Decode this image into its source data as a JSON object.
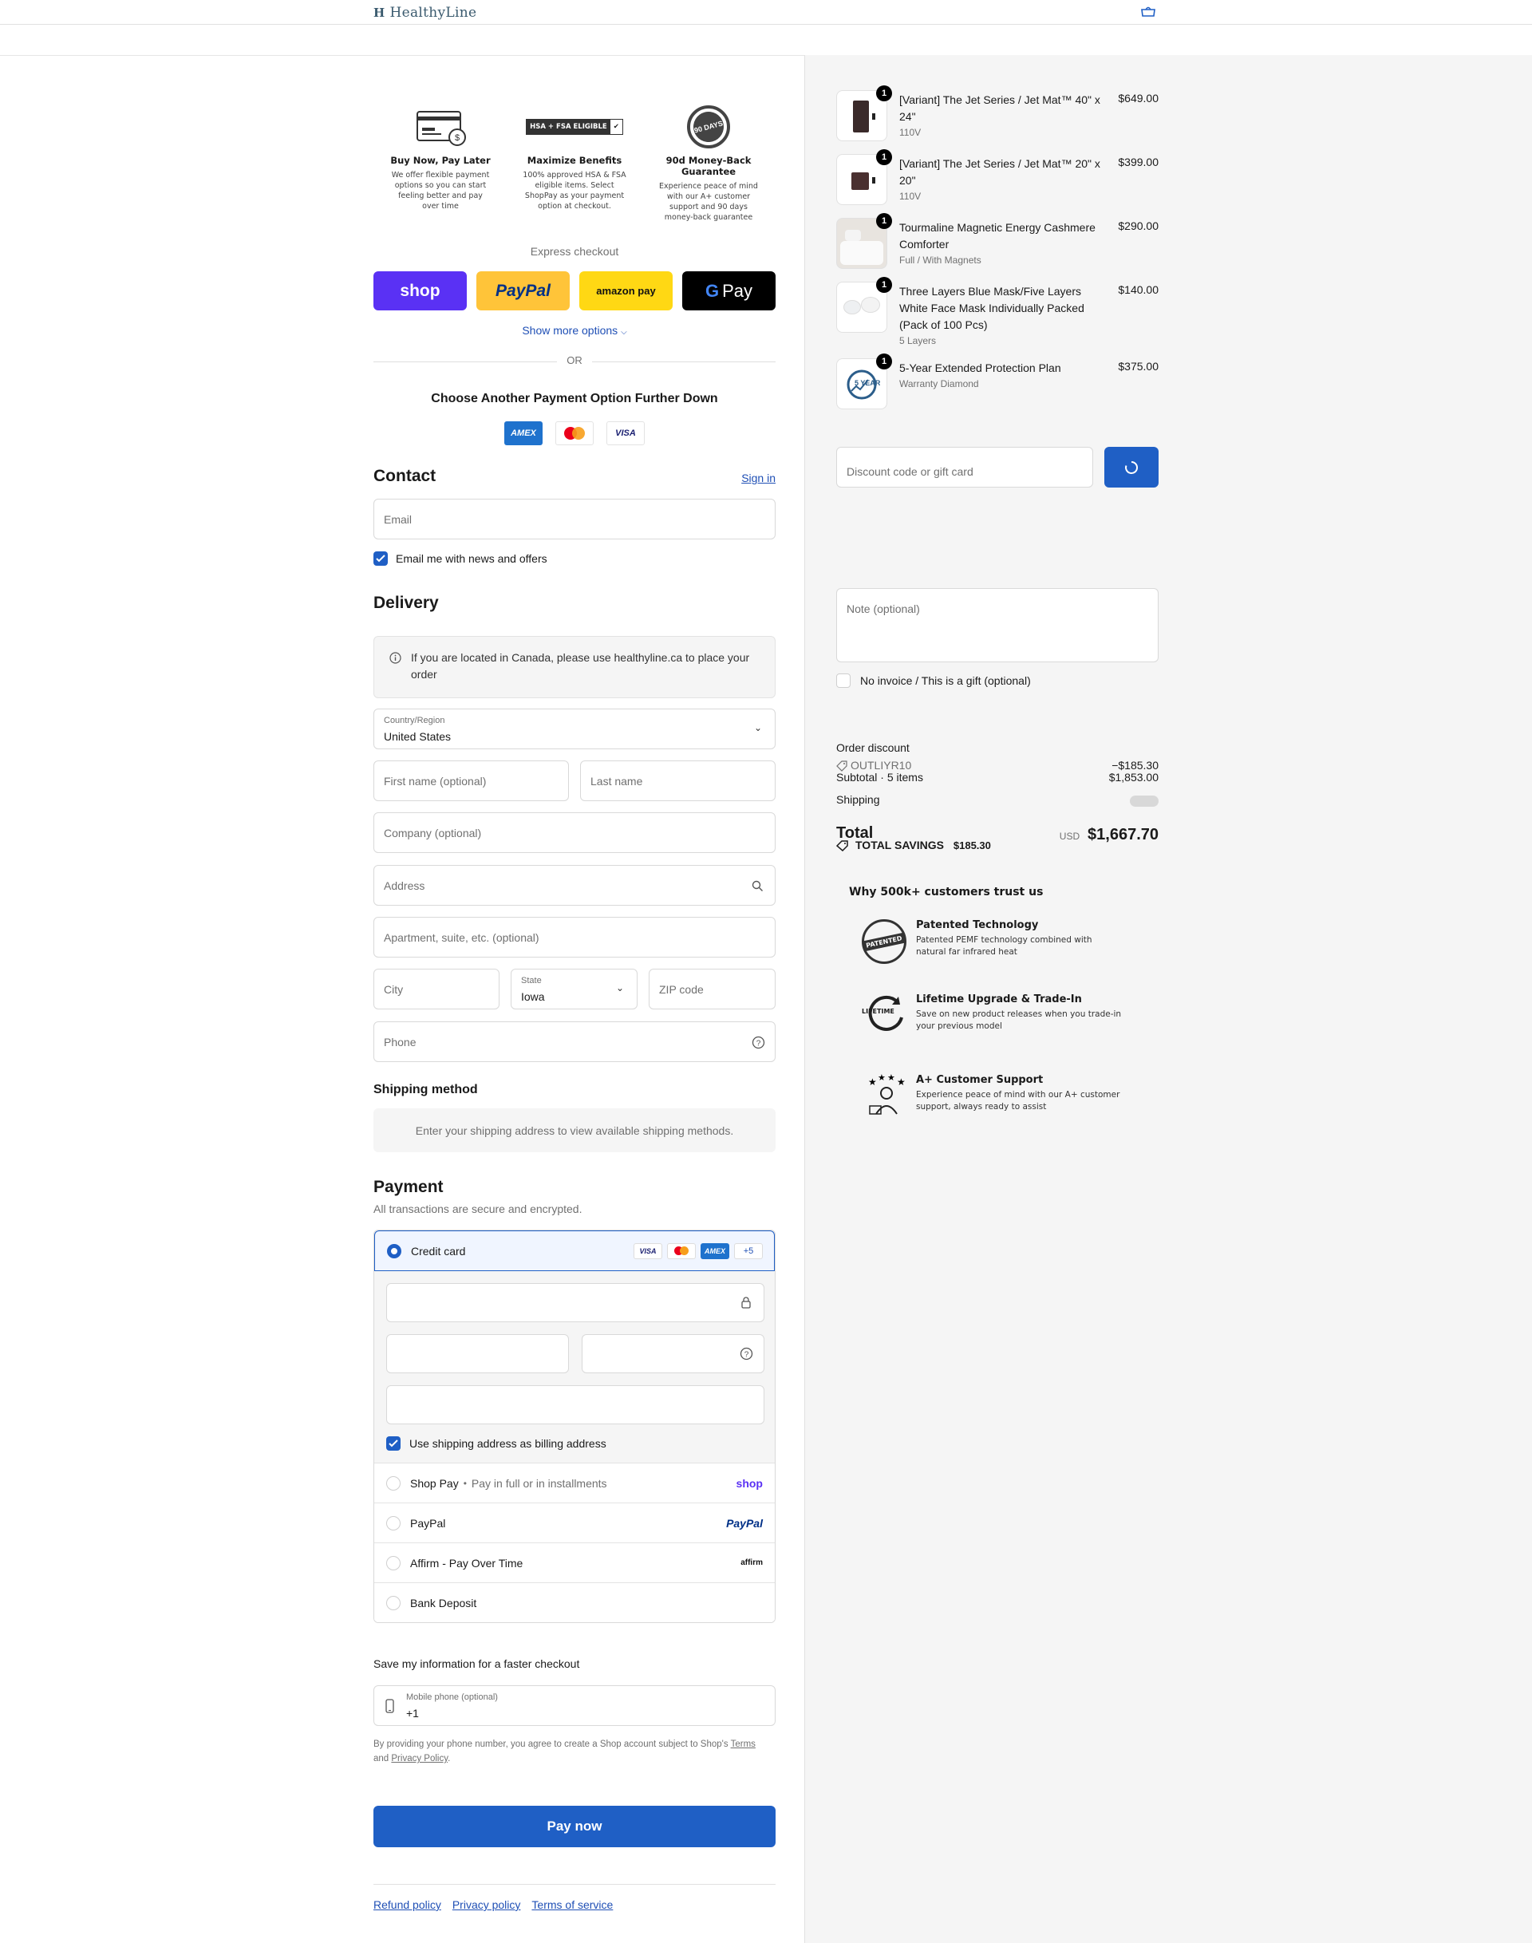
{
  "header": {
    "brand": "HealthyLine"
  },
  "trust_badges": [
    {
      "title": "Buy Now, Pay Later",
      "desc": "We offer flexible payment options so you can start feeling better and pay over time"
    },
    {
      "title": "Maximize Benefits",
      "desc": "100% approved HSA & FSA eligible items. Select ShopPay as your payment option at checkout.",
      "art": "HSA + FSA ELIGIBLE"
    },
    {
      "title": "90d Money-Back Guarantee",
      "desc": "Experience peace of mind with our A+ customer support and 90 days money-back guarantee",
      "art": "90 DAYS"
    }
  ],
  "express": {
    "label": "Express checkout",
    "shop": "shop",
    "paypal": "PayPal",
    "amazon": "amazon pay",
    "gpay": "Pay",
    "more": "Show more options",
    "or": "OR"
  },
  "choose_title": "Choose Another Payment Option Further Down",
  "card_logos": {
    "amex": "AMEX",
    "visa": "VISA"
  },
  "contact": {
    "title": "Contact",
    "sign_in": "Sign in",
    "email_placeholder": "Email",
    "news_label": "Email me with news and offers"
  },
  "delivery": {
    "title": "Delivery",
    "info": "If you are located in Canada, please use healthyline.ca to place your order",
    "country_label": "Country/Region",
    "country_value": "United States",
    "first_name": "First name (optional)",
    "last_name": "Last name",
    "company": "Company (optional)",
    "address": "Address",
    "apartment": "Apartment, suite, etc. (optional)",
    "city": "City",
    "state_label": "State",
    "state_value": "Iowa",
    "zip": "ZIP code",
    "phone": "Phone"
  },
  "shipping": {
    "title": "Shipping method",
    "message": "Enter your shipping address to view available shipping methods."
  },
  "payment": {
    "title": "Payment",
    "subtitle": "All transactions are secure and encrypted.",
    "credit_card": "Credit card",
    "more_cards": "+5",
    "billing_label": "Use shipping address as billing address",
    "shop_pay": "Shop Pay",
    "shop_pay_sub": "Pay in full or in installments",
    "shop_pay_brand": "shop",
    "paypal": "PayPal",
    "paypal_brand": "PayPal",
    "affirm": "Affirm - Pay Over Time",
    "affirm_brand": "affirm",
    "bank": "Bank Deposit"
  },
  "save_info": {
    "title": "Save my information for a faster checkout",
    "phone_label": "Mobile phone (optional)",
    "phone_value": "+1",
    "legal_1": "By providing your phone number, you agree to create a Shop account subject to Shop's",
    "terms": "Terms",
    "legal_2": "and",
    "privacy": "Privacy Policy",
    "legal_end": "."
  },
  "pay_now": "Pay now",
  "footer": [
    "Refund policy",
    "Privacy policy",
    "Terms of service"
  ],
  "order": {
    "items": [
      {
        "qty": "1",
        "name": "[Variant] The Jet Series / Jet Mat™ 40\" x 24\"",
        "variant": "110V",
        "price": "$649.00"
      },
      {
        "qty": "1",
        "name": "[Variant] The Jet Series / Jet Mat™ 20\" x 20\"",
        "variant": "110V",
        "price": "$399.00"
      },
      {
        "qty": "1",
        "name": "Tourmaline Magnetic Energy Cashmere Comforter",
        "variant": "Full / With Magnets",
        "price": "$290.00"
      },
      {
        "qty": "1",
        "name": "Three Layers Blue Mask/Five Layers White Face Mask Individually Packed (Pack of 100 Pcs)",
        "variant": "5 Layers",
        "price": "$140.00"
      },
      {
        "qty": "1",
        "name": "5-Year Extended Protection Plan",
        "variant": "Warranty Diamond",
        "price": "$375.00"
      }
    ],
    "discount_placeholder": "Discount code or gift card",
    "note_placeholder": "Note (optional)",
    "gift_label": "No invoice / This is a gift (optional)",
    "order_discount_label": "Order discount",
    "discount_code": "OUTLIYR10",
    "discount_amount": "−$185.30",
    "subtotal_label": "Subtotal · 5 items",
    "subtotal": "$1,853.00",
    "shipping_label": "Shipping",
    "total_label": "Total",
    "currency": "USD",
    "total": "$1,667.70",
    "savings_label": "TOTAL SAVINGS",
    "savings": "$185.30"
  },
  "why": {
    "title": "Why 500k+ customers trust us",
    "items": [
      {
        "title": "Patented Technology",
        "desc": "Patented PEMF technology combined with natural far infrared heat",
        "art": "PATENTED"
      },
      {
        "title": "Lifetime Upgrade & Trade-In",
        "desc": "Save on new product releases when you trade-in your previous model",
        "art": "LIFETIME"
      },
      {
        "title": "A+ Customer Support",
        "desc": "Experience peace of mind with our A+ customer support, always ready to assist"
      }
    ]
  },
  "colors": {
    "accent": "#1f5fc5",
    "shop": "#5a31f4",
    "paypal": "#ffc439",
    "amazon": "#ffd814"
  }
}
